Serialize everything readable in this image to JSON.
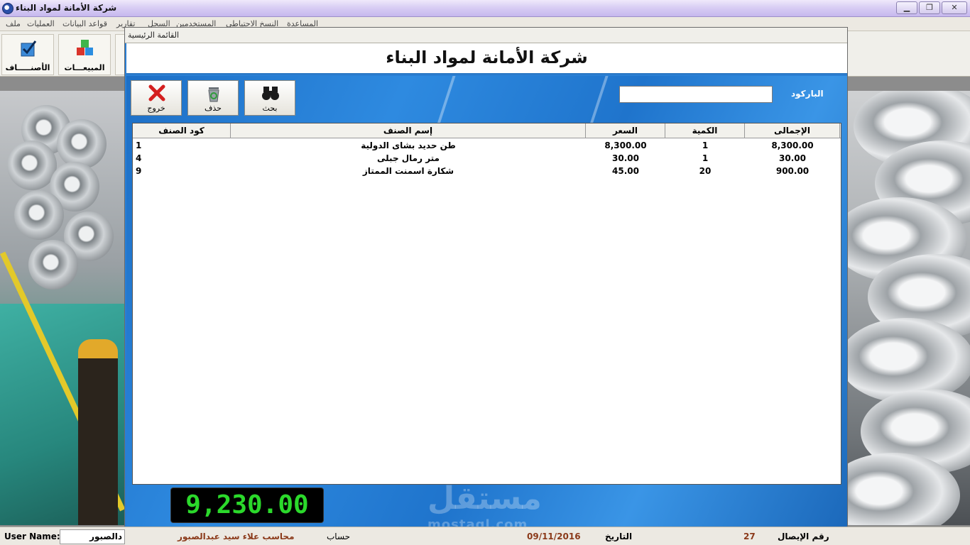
{
  "window": {
    "title": "شركة الأمانة لمواد البناء",
    "controls": {
      "minimize": "▁",
      "restore": "❐",
      "close": "✕"
    }
  },
  "menu": [
    "ملف",
    "العمليات",
    "قواعد البيانات",
    "تقارير",
    "السجل",
    "المستخدمين",
    "النسخ الاحتياطي",
    "المساعدة"
  ],
  "toolbar": {
    "items_label": "الأصنـــــاف",
    "sales_label": "المبيعـــات",
    "items_icon": "check-box-icon",
    "sales_icon": "cubes-icon"
  },
  "child": {
    "title": "القائمة الرئيسية",
    "company_name": "شركة الأمانة لمواد البناء",
    "buttons": {
      "exit": "خروج",
      "delete": "حذف",
      "search": "بحث"
    },
    "barcode_label": "الباركود",
    "barcode_value": ""
  },
  "table": {
    "headers": {
      "code": "كود الصنف",
      "name": "إسم الصنف",
      "price": "السعر",
      "qty": "الكمية",
      "total": "الإجمالى"
    },
    "rows": [
      {
        "code": "1",
        "name": "طن حديد بشاى الدولية",
        "price": "8,300.00",
        "qty": "1",
        "total": "8,300.00"
      },
      {
        "code": "4",
        "name": "متر رمال جبلى",
        "price": "30.00",
        "qty": "1",
        "total": "30.00"
      },
      {
        "code": "9",
        "name": "شكارة اسمنت الممتاز",
        "price": "45.00",
        "qty": "20",
        "total": "900.00"
      }
    ]
  },
  "grand_total": "9,230.00",
  "watermark": {
    "ar": "مستقل",
    "en": "mostaql.com"
  },
  "status": {
    "user_label": "User Name:",
    "user_value": "دالصبور",
    "account_name": "محاسب علاء سيد عبدالصبور",
    "account_label": "حساب",
    "date_value": "09/11/2016",
    "date_label": "التاريخ",
    "receipt_value": "27",
    "receipt_label": "رقم الإيصال"
  },
  "colors": {
    "accent_blue": "#2a7fd4",
    "total_green": "#2bd92b",
    "status_brown": "#8b3a1a"
  }
}
